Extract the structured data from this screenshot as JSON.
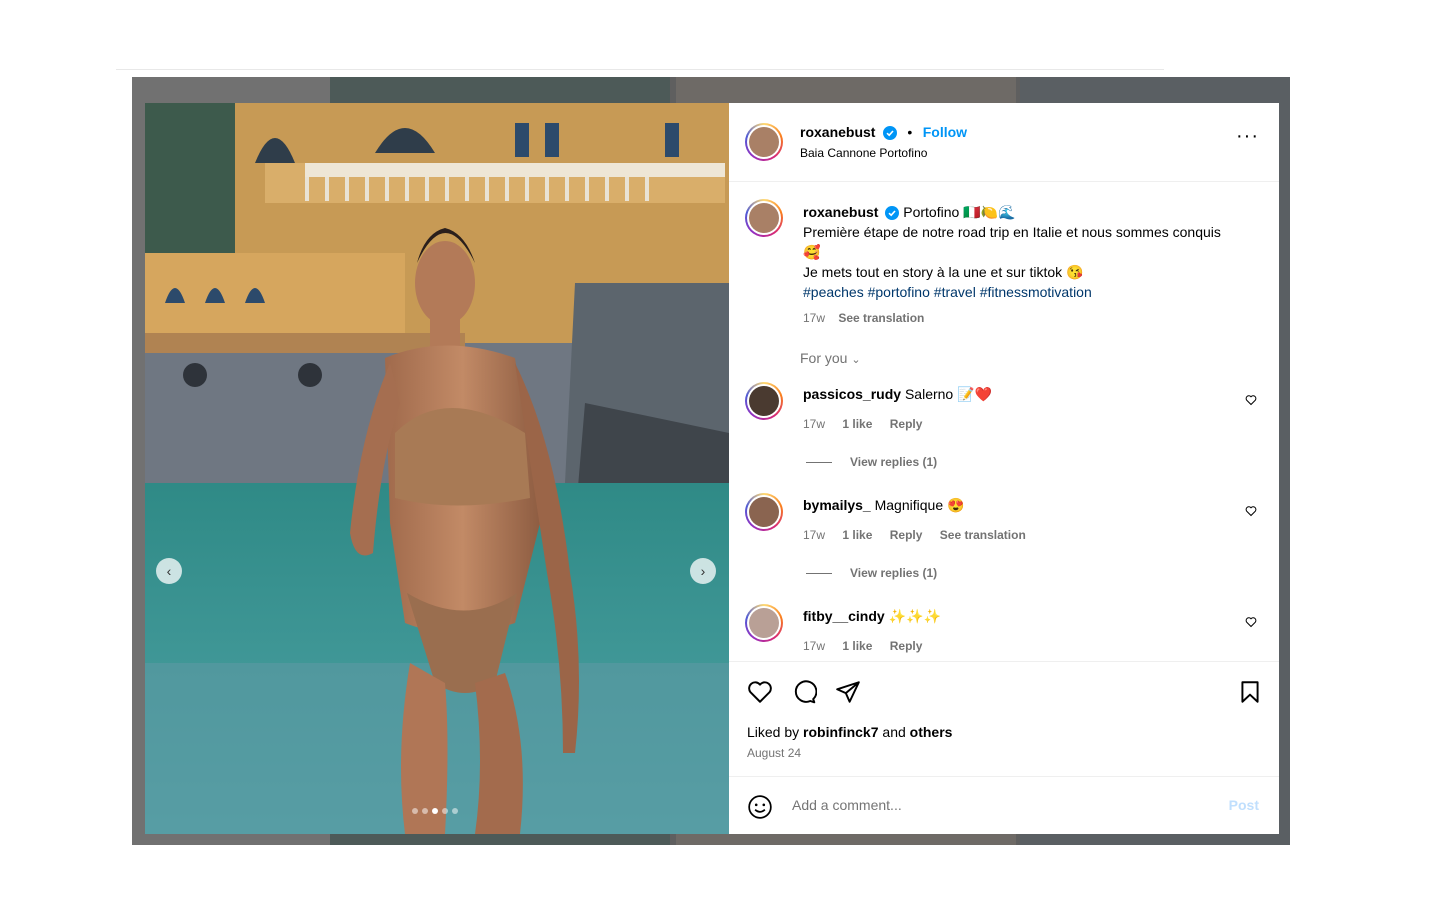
{
  "post": {
    "username": "roxanebust",
    "follow_label": "Follow",
    "location": "Baia Cannone Portofino",
    "caption_title": "Portofino 🇮🇹🍋🌊",
    "caption_line1": "Première étape de notre road trip en Italie et nous sommes conquis 🥰",
    "caption_line2": "Je mets tout en story à la une et sur tiktok 😘",
    "hashtags": [
      "#peaches",
      "#portofino",
      "#travel",
      "#fitnessmotivation"
    ],
    "caption_time": "17w",
    "see_translation": "See translation",
    "sort_label": "For you",
    "carousel_index": 3,
    "carousel_total": 5
  },
  "comments": [
    {
      "username": "passicos_rudy",
      "text": "Salerno 📝❤️",
      "time": "17w",
      "likes": "1 like",
      "reply": "Reply",
      "translate": "",
      "view_replies": "View replies (1)"
    },
    {
      "username": "bymailys_",
      "text": "Magnifique 😍",
      "time": "17w",
      "likes": "1 like",
      "reply": "Reply",
      "translate": "See translation",
      "view_replies": "View replies (1)"
    },
    {
      "username": "fitby__cindy",
      "text": "✨✨✨",
      "time": "17w",
      "likes": "1 like",
      "reply": "Reply",
      "translate": "",
      "view_replies": ""
    }
  ],
  "footer": {
    "liked_prefix": "Liked by",
    "liked_user": "robinfinck7",
    "liked_and": "and",
    "liked_others": "others",
    "date": "August 24",
    "comment_placeholder": "Add a comment...",
    "post_label": "Post"
  },
  "colors": {
    "accent": "#0095f6",
    "hashtag": "#00376b",
    "muted": "#737373"
  }
}
